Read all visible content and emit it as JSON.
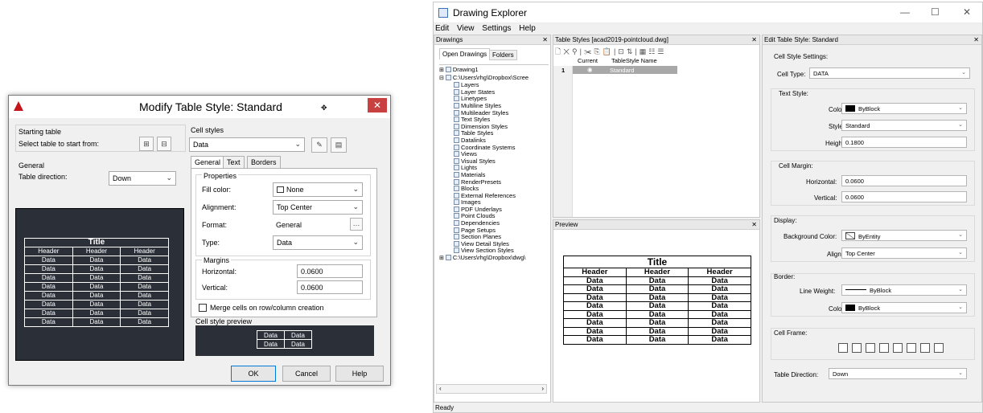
{
  "dialog": {
    "title": "Modify Table Style: Standard",
    "close": "✕",
    "starting_table_label": "Starting table",
    "select_table_label": "Select table to start from:",
    "general_label": "General",
    "table_direction_label": "Table direction:",
    "table_direction_value": "Down",
    "cell_styles_label": "Cell styles",
    "cell_style_value": "Data",
    "tabs": [
      "General",
      "Text",
      "Borders"
    ],
    "properties_label": "Properties",
    "fill_color_label": "Fill color:",
    "fill_color_value": "None",
    "alignment_label": "Alignment:",
    "alignment_value": "Top Center",
    "format_label": "Format:",
    "format_value": "General",
    "type_label": "Type:",
    "type_value": "Data",
    "margins_label": "Margins",
    "horizontal_label": "Horizontal:",
    "horizontal_value": "0.0600",
    "vertical_label": "Vertical:",
    "vertical_value": "0.0600",
    "merge_label": "Merge cells on row/column creation",
    "cell_preview_label": "Cell style preview",
    "ok": "OK",
    "cancel": "Cancel",
    "help": "Help",
    "preview": {
      "title": "Title",
      "headers": [
        "Header",
        "Header",
        "Header"
      ],
      "cell": "Data",
      "rows": 8
    },
    "cell_preview_cells": [
      "Data",
      "Data",
      "Data",
      "Data"
    ]
  },
  "explorer": {
    "title": "Drawing Explorer",
    "menu": [
      "Edit",
      "View",
      "Settings",
      "Help"
    ],
    "drawings_pane": "Drawings",
    "tabs": [
      "Open Drawings",
      "Folders"
    ],
    "tree": [
      "Drawing1",
      "C:\\Users\\rhg\\Dropbox\\Scree",
      "Layers",
      "Layer States",
      "Linetypes",
      "Multiline Styles",
      "Multileader Styles",
      "Text Styles",
      "Dimension Styles",
      "Table Styles",
      "Datalinks",
      "Coordinate Systems",
      "Views",
      "Visual Styles",
      "Lights",
      "Materials",
      "RenderPresets",
      "Blocks",
      "External References",
      "Images",
      "PDF Underlays",
      "Point Clouds",
      "Dependencies",
      "Page Setups",
      "Section Planes",
      "View Detail Styles",
      "View Section Styles",
      "C:\\Users\\rhg\\Dropbox\\dwg\\"
    ],
    "table_styles_pane": "Table Styles [acad2019-pointcloud.dwg]",
    "columns": [
      "Current",
      "TableStyle Name"
    ],
    "rows": [
      {
        "num": "1",
        "current": "◉",
        "name": "Standard"
      }
    ],
    "preview_pane": "Preview",
    "preview": {
      "title": "Title",
      "headers": [
        "Header",
        "Header",
        "Header"
      ],
      "cell": "Data",
      "rows": 8
    },
    "edit_pane": "Edit Table Style: Standard",
    "cell_style_settings": "Cell Style Settings:",
    "cell_type_label": "Cell Type:",
    "cell_type_value": "DATA",
    "text_style_label": "Text Style:",
    "color_label": "Color:",
    "color_value": "ByBlock",
    "style_label": "Style:",
    "style_value": "Standard",
    "height_label": "Height:",
    "height_value": "0.1800",
    "cell_margin_label": "Cell Margin:",
    "horizontal_label": "Horizontal:",
    "horizontal_value": "0.0600",
    "vertical_label": "Vertical:",
    "vertical_value": "0.0600",
    "display_label": "Display:",
    "bg_color_label": "Background Color:",
    "bg_color_value": "ByEntity",
    "align_label": "Align:",
    "align_value": "Top Center",
    "border_label": "Border:",
    "line_weight_label": "Line Weight:",
    "line_weight_value": "ByBlock",
    "border_color_label": "Color:",
    "border_color_value": "ByBlock",
    "cell_frame_label": "Cell Frame:",
    "table_direction_label": "Table Direction:",
    "table_direction_value": "Down",
    "status": "Ready"
  }
}
